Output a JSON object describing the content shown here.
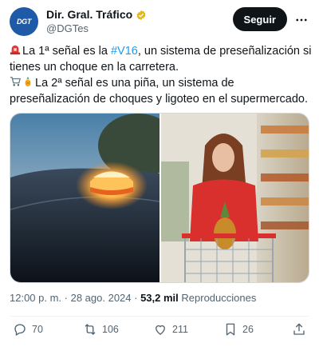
{
  "tweet": {
    "author": {
      "display_name": "Dir. Gral. Tráfico",
      "handle": "@DGTes",
      "avatar_text": "DGT",
      "verified_badge": "gold-verified-icon"
    },
    "follow_label": "Seguir",
    "more_icon": "more-horizontal-icon",
    "text": {
      "line1_before": "La 1ª señal es la ",
      "line1_hashtag": "#V16",
      "line1_after": ", un sistema de preseñalización si tienes un choque en la carretera.",
      "line2": "La 2ª señal es una piña, un sistema de preseñalización de choques y ligoteo en el supermercado.",
      "emojis": [
        "rotating-light-icon",
        "shopping-cart-icon",
        "pineapple-icon"
      ]
    },
    "media": {
      "image1": "v16-beacon-on-car-roof",
      "image2": "woman-with-pineapple-in-shopping-cart"
    },
    "meta": {
      "time": "12:00 p. m.",
      "separator": " · ",
      "date": "28 ago. 2024",
      "views_count": "53,2 mil",
      "views_label": " Reproducciones"
    },
    "actions": {
      "replies": "70",
      "retweets": "106",
      "likes": "211",
      "bookmarks": "26"
    }
  },
  "colors": {
    "accent": "#1d9bf0",
    "text": "#0f1419",
    "secondary": "#536471",
    "verified_gold": "#e2b719",
    "avatar_bg": "#1e5aa8"
  }
}
